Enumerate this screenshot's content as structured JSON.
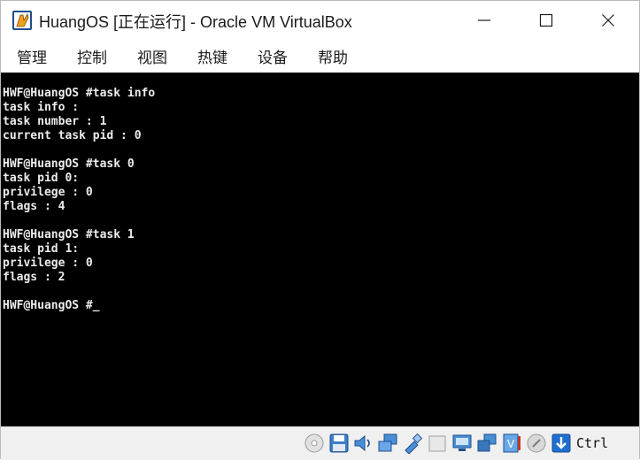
{
  "window": {
    "title": "HuangOS [正在运行] - Oracle VM VirtualBox"
  },
  "menu": [
    {
      "label": "管理"
    },
    {
      "label": "控制"
    },
    {
      "label": "视图"
    },
    {
      "label": "热键"
    },
    {
      "label": "设备"
    },
    {
      "label": "帮助"
    }
  ],
  "console": {
    "lines": [
      "HWF@HuangOS #task info",
      "task info :",
      "task number : 1",
      "current task pid : 0",
      "",
      "HWF@HuangOS #task 0",
      "task pid 0:",
      "privilege : 0",
      "flags : 4",
      "",
      "HWF@HuangOS #task 1",
      "task pid 1:",
      "privilege : 0",
      "flags : 2",
      "",
      "HWF@HuangOS #_"
    ]
  },
  "statusbar": {
    "icons": [
      "optical-drive-icon",
      "floppy-icon",
      "audio-icon",
      "network-icon",
      "usb-icon",
      "shared-folders-icon",
      "display-icon",
      "snapshot-icon",
      "vrde-icon",
      "recording-icon",
      "mouse-integration-icon",
      "keyboard-capture-icon"
    ],
    "host_key": "Ctrl"
  }
}
